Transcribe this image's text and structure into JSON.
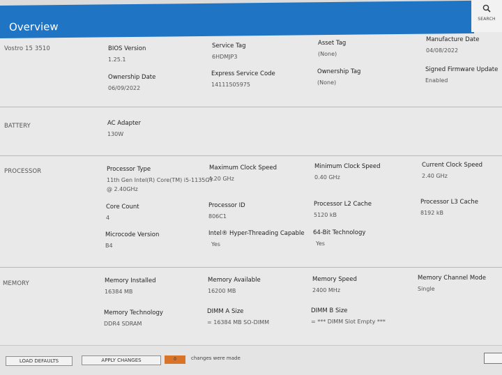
{
  "header": {
    "title": "Overview"
  },
  "search": {
    "label": "SEARCH",
    "icon": "search-icon"
  },
  "sections": {
    "system": {
      "model": "Vostro 15 3510"
    },
    "battery": {
      "label": "BATTERY"
    },
    "processor": {
      "label": "PROCESSOR"
    },
    "memory": {
      "label": "MEMORY"
    }
  },
  "fields": {
    "bios_version": {
      "label": "BIOS Version",
      "value": "1.25.1"
    },
    "service_tag": {
      "label": "Service Tag",
      "value": "6HDMJP3"
    },
    "asset_tag": {
      "label": "Asset Tag",
      "value": "(None)"
    },
    "manufacture_date": {
      "label": "Manufacture Date",
      "value": "04/08/2022"
    },
    "ownership_date": {
      "label": "Ownership Date",
      "value": "06/09/2022"
    },
    "express_service_code": {
      "label": "Express Service Code",
      "value": "14111505975"
    },
    "ownership_tag": {
      "label": "Ownership Tag",
      "value": "(None)"
    },
    "signed_firmware_update": {
      "label": "Signed Firmware Update",
      "value": "Enabled"
    },
    "ac_adapter": {
      "label": "AC Adapter",
      "value": "130W"
    },
    "processor_type": {
      "label": "Processor Type",
      "value_line1": "11th Gen Intel(R) Core(TM) i5-1135G7",
      "value_line2": "@ 2.40GHz"
    },
    "max_clock": {
      "label": "Maximum Clock Speed",
      "value": "4.20 GHz"
    },
    "min_clock": {
      "label": "Minimum Clock Speed",
      "value": "0.40 GHz"
    },
    "current_clock": {
      "label": "Current Clock Speed",
      "value": "2.40 GHz"
    },
    "core_count": {
      "label": "Core Count",
      "value": "4"
    },
    "processor_id": {
      "label": "Processor ID",
      "value": "806C1"
    },
    "l2_cache": {
      "label": "Processor L2 Cache",
      "value": "5120 kB"
    },
    "l3_cache": {
      "label": "Processor L3 Cache",
      "value": "8192 kB"
    },
    "microcode": {
      "label": "Microcode Version",
      "value": "B4"
    },
    "hyperthreading": {
      "label": "Intel® Hyper-Threading Capable",
      "value": "Yes"
    },
    "x64": {
      "label": "64-Bit Technology",
      "value": "Yes"
    },
    "mem_installed": {
      "label": "Memory Installed",
      "value": "16384 MB"
    },
    "mem_available": {
      "label": "Memory Available",
      "value": "16200 MB"
    },
    "mem_speed": {
      "label": "Memory Speed",
      "value": "2400 MHz"
    },
    "mem_channel": {
      "label": "Memory Channel Mode",
      "value": "Single"
    },
    "mem_tech": {
      "label": "Memory Technology",
      "value": "DDR4 SDRAM"
    },
    "dimm_a": {
      "label": "DIMM A Size",
      "value": "= 16384 MB SO-DIMM"
    },
    "dimm_b": {
      "label": "DIMM B Size",
      "value": "= *** DIMM Slot Empty ***"
    }
  },
  "footer": {
    "load_defaults": "LOAD DEFAULTS",
    "apply_changes": "APPLY CHANGES",
    "change_count": "0",
    "changes_text": "changes were made"
  }
}
